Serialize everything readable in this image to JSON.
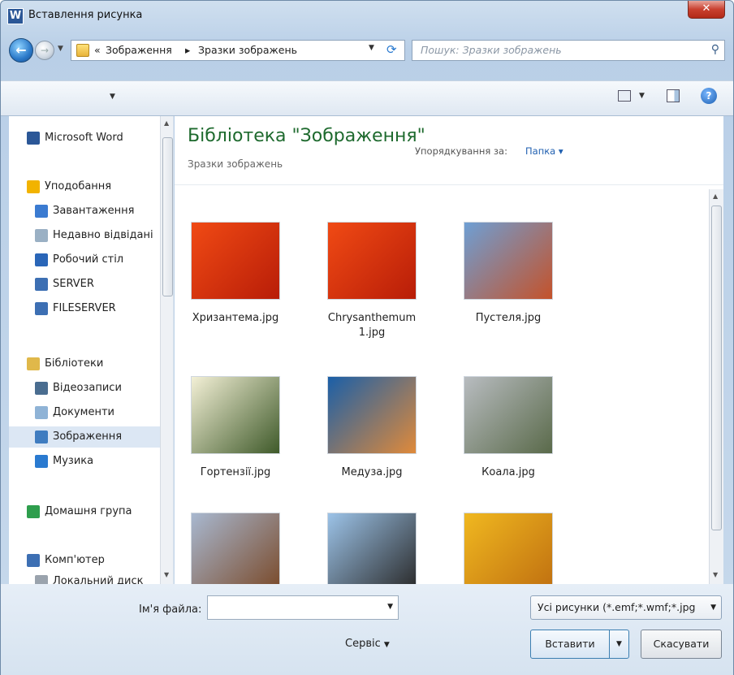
{
  "window": {
    "title": "Вставлення рисунка",
    "app_icon": "W",
    "close": "✕"
  },
  "address": {
    "prefix": "«",
    "crumb1": "Зображення",
    "sep": "▸",
    "crumb2": "Зразки зображень",
    "search_placeholder": "Пошук: Зразки зображень"
  },
  "nav": {
    "items": [
      {
        "label": "Microsoft Word",
        "icon": "word-icon",
        "color": "#2b5797"
      },
      {
        "label": "Уподобання",
        "icon": "star-icon",
        "color": "#f2b300"
      },
      {
        "label": "Завантаження",
        "icon": "downloads-icon",
        "color": "#3b7bd1"
      },
      {
        "label": "Недавно відвідані",
        "icon": "recent-places-icon",
        "color": "#9ab0c4"
      },
      {
        "label": "Робочий стіл",
        "icon": "desktop-icon",
        "color": "#2a66b8"
      },
      {
        "label": "SERVER",
        "icon": "computer-icon",
        "color": "#3d6fb3"
      },
      {
        "label": "FILESERVER",
        "icon": "computer-icon",
        "color": "#3d6fb3"
      },
      {
        "label": "Бібліотеки",
        "icon": "libraries-icon",
        "color": "#e0b84a"
      },
      {
        "label": "Відеозаписи",
        "icon": "videos-icon",
        "color": "#4a6d90"
      },
      {
        "label": "Документи",
        "icon": "documents-icon",
        "color": "#8fb3d6"
      },
      {
        "label": "Зображення",
        "icon": "pictures-icon",
        "color": "#3f7cc0"
      },
      {
        "label": "Музика",
        "icon": "music-icon",
        "color": "#2a7ad0"
      },
      {
        "label": "Домашня група",
        "icon": "homegroup-icon",
        "color": "#2e9e4d"
      },
      {
        "label": "Комп'ютер",
        "icon": "computer-icon",
        "color": "#3d6fb3"
      },
      {
        "label": "Локальний диск",
        "icon": "drive-icon",
        "color": "#9aa3ad"
      }
    ]
  },
  "library": {
    "title": "Бібліотека \"Зображення\"",
    "subtitle": "Зразки зображень",
    "arrange_label": "Упорядкування за:",
    "arrange_value": "Папка ▾"
  },
  "files": [
    {
      "name": "Хризантема.jpg",
      "colors": [
        "#f04a14",
        "#b81d08"
      ]
    },
    {
      "name": "Chrysanthemum 1.jpg",
      "colors": [
        "#f04a14",
        "#b81d08"
      ]
    },
    {
      "name": "Пустеля.jpg",
      "colors": [
        "#6e9fd4",
        "#c4522a"
      ]
    },
    {
      "name": "Гортензії.jpg",
      "colors": [
        "#f3f0d6",
        "#3f5a2a"
      ]
    },
    {
      "name": "Медуза.jpg",
      "colors": [
        "#1a5fa8",
        "#e08a3a"
      ]
    },
    {
      "name": "Коала.jpg",
      "colors": [
        "#b8bcc0",
        "#5a6a4a"
      ]
    },
    {
      "name": "",
      "colors": [
        "#a8b8d0",
        "#7a4a2a"
      ]
    },
    {
      "name": "",
      "colors": [
        "#9cc3e8",
        "#2a2a2a"
      ]
    },
    {
      "name": "",
      "colors": [
        "#f0b820",
        "#c07010"
      ]
    }
  ],
  "bottom": {
    "filename_label": "Ім'я файла:",
    "filename_value": "",
    "filter": "Усі рисунки (*.emf;*.wmf;*.jpg",
    "tools": "Сервіс",
    "insert": "Вставити",
    "cancel": "Скасувати"
  },
  "icons": {
    "back": "back-arrow-icon",
    "forward": "forward-arrow-icon",
    "refresh": "refresh-icon",
    "search": "search-icon",
    "help": "help-icon"
  }
}
